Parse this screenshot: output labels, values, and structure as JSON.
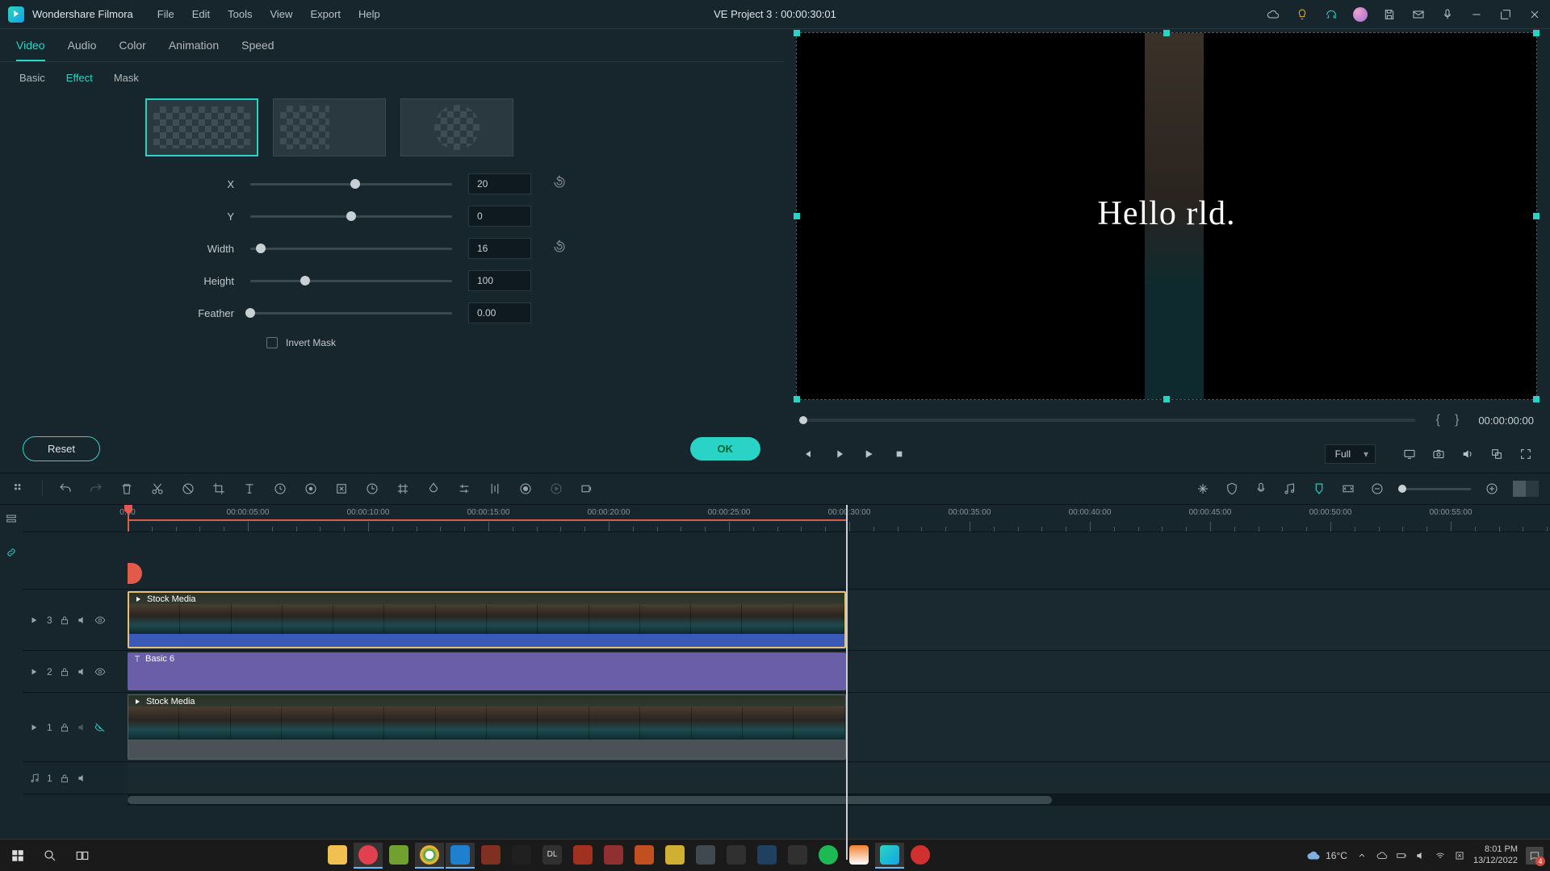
{
  "app_name": "Wondershare Filmora",
  "menu": [
    "File",
    "Edit",
    "Tools",
    "View",
    "Export",
    "Help"
  ],
  "project_title": "VE Project 3 : 00:00:30:01",
  "prop_tabs": [
    "Video",
    "Audio",
    "Color",
    "Animation",
    "Speed"
  ],
  "sub_tabs": [
    "Basic",
    "Effect",
    "Mask"
  ],
  "sliders": {
    "x": {
      "label": "X",
      "value": "20",
      "pct": 52
    },
    "y": {
      "label": "Y",
      "value": "0",
      "pct": 50
    },
    "w": {
      "label": "Width",
      "value": "16",
      "pct": 5
    },
    "h": {
      "label": "Height",
      "value": "100",
      "pct": 27
    },
    "f": {
      "label": "Feather",
      "value": "0.00",
      "pct": 0
    }
  },
  "invert_label": "Invert Mask",
  "btn_reset": "Reset",
  "btn_ok": "OK",
  "preview_text": "Hello    rld.",
  "preview_time": "00:00:00:00",
  "quality": "Full",
  "ruler_labels": [
    "0:00",
    "00:00:05:00",
    "00:00:10:00",
    "00:00:15:00",
    "00:00:20:00",
    "00:00:25:00",
    "00:00:30:00",
    "00:00:35:00",
    "00:00:40:00",
    "00:00:45:00",
    "00:00:50:00",
    "00:00:55:00"
  ],
  "tracks": {
    "t3": {
      "num": "3",
      "clip": "Stock Media"
    },
    "t2": {
      "num": "2",
      "clip": "Basic 6"
    },
    "t1": {
      "num": "1",
      "clip": "Stock Media"
    },
    "a1": {
      "num": "1"
    }
  },
  "weather": "16°C",
  "clock_time": "8:01 PM",
  "clock_date": "13/12/2022"
}
